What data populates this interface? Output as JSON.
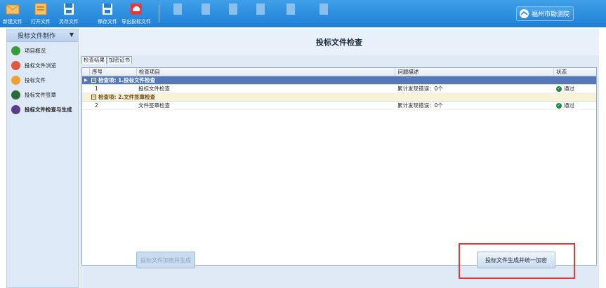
{
  "toolbar": {
    "buttons": [
      {
        "label": "新建文件",
        "icon": "new-file-icon",
        "enabled": true
      },
      {
        "label": "打开文件",
        "icon": "open-file-icon",
        "enabled": true
      },
      {
        "label": "另存文件",
        "icon": "save-as-icon",
        "enabled": true
      },
      {
        "label": "保存文件",
        "icon": "save-icon",
        "enabled": true
      },
      {
        "label": "导出投标文件",
        "icon": "export-cloud-icon",
        "enabled": true
      },
      {
        "label": "",
        "icon": "doc-icon",
        "enabled": false
      },
      {
        "label": "",
        "icon": "doc-icon",
        "enabled": false
      },
      {
        "label": "",
        "icon": "doc-icon",
        "enabled": false
      },
      {
        "label": "",
        "icon": "doc-icon",
        "enabled": false
      },
      {
        "label": "",
        "icon": "doc-icon",
        "enabled": false
      },
      {
        "label": "",
        "icon": "doc-icon",
        "enabled": false
      }
    ],
    "org_name": "福州市勘测院"
  },
  "sidebar": {
    "header": "投标文件制作",
    "items": [
      {
        "label": "项目概况",
        "icon": "project-overview-icon",
        "color": "#3a9a3e"
      },
      {
        "label": "投标文件浏览",
        "icon": "browse-icon",
        "color": "#e2583e"
      },
      {
        "label": "投标文件",
        "icon": "bid-file-icon",
        "color": "#f0a030"
      },
      {
        "label": "投标文件签章",
        "icon": "signature-icon",
        "color": "#2d6a3a"
      },
      {
        "label": "投标文件检查与生成",
        "icon": "check-generate-icon",
        "color": "#5a3d8a",
        "active": true
      }
    ]
  },
  "main": {
    "title": "投标文件检查",
    "tabs": [
      {
        "label": "检查结果",
        "active": true
      },
      {
        "label": "加密证书",
        "active": false
      }
    ],
    "table": {
      "columns": [
        "序号",
        "检查项目",
        "问题描述",
        "状态"
      ],
      "groups": [
        {
          "label": "检查项: 1.投标文件检查",
          "row": {
            "no": "1",
            "item": "投标文件检查",
            "desc": "累计发现错误：0个",
            "status": "通过"
          }
        },
        {
          "label": "检查项: 2.文件签章检查",
          "row": {
            "no": "2",
            "item": "文件签章检查",
            "desc": "累计发现错误：0个",
            "status": "通过"
          }
        }
      ]
    },
    "buttons": {
      "encrypt_generate": "投标文件加密并生成",
      "generate_unified_encrypt": "投标文件生成并统一加密"
    }
  },
  "colors": {
    "toolbar": "#2b8ce0",
    "highlight": "#e53935",
    "group1": "#5579b8",
    "ok": "#1c8a3a"
  }
}
